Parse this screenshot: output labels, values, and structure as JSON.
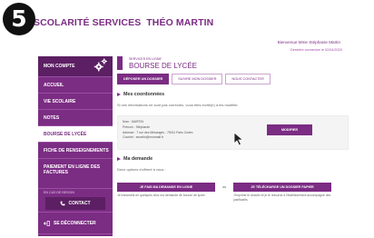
{
  "step_number": "5",
  "header": {
    "brand": "SCOLARITÉ SERVICES",
    "student_name": "THÉO MARTIN",
    "user_greeting": "Bienvenue Mme Stéphanie Martin",
    "last_login": "Dernière connexion le 02/04/2020"
  },
  "sidebar": {
    "account_label": "MON COMPTE",
    "items": [
      {
        "label": "ACCUEIL"
      },
      {
        "label": "VIE SCOLAIRE"
      },
      {
        "label": "NOTES"
      },
      {
        "label": "BOURSE DE LYCÉE"
      },
      {
        "label": "FICHE DE RENSEIGNEMENTS"
      },
      {
        "label": "PAIEMENT EN LIGNE DES FACTURES"
      }
    ],
    "active_index": 3,
    "contact_title": "EN CAS DE BESOIN",
    "contact_button": "CONTACT",
    "logout_label": "SE DÉCONNECTER"
  },
  "main": {
    "breadcrumb_small": "SERVICES EN LIGNE",
    "page_title": "BOURSE DE LYCÉE",
    "tabs": [
      {
        "label": "DÉPOSER UN DOSSIER",
        "active": true
      },
      {
        "label": "SUIVRE MON DOSSIER",
        "active": false
      },
      {
        "label": "NOUS CONTACTER",
        "active": false
      }
    ],
    "coords_heading": "Mes coordonnées",
    "coords_intro": "Si ces informations ne sont pas correctes, vous êtes invité(e) à les modifier.",
    "info_lines": [
      "Nom : MARTIN",
      "Prénom : Stéphanie",
      "Adresse : 7 rue des Mésanges - 75011 Paris Cedex",
      "Courriel : smartin@monmail.fr"
    ],
    "modify_button": "MODIFIER",
    "request_heading": "Ma demande",
    "request_intro": "Deux options s'offrent à vous :",
    "option_online_button": "JE FAIS MA DEMANDE EN LIGNE",
    "or_label": "ou",
    "option_download_button": "JE TÉLÉCHARGE UN DOSSIER PAPIER",
    "option_online_desc": "Je transmets en quelques clics ma demande de bourse de lycée.",
    "option_download_desc": "J'imprime le dossier et je le retourne à l'établissement accompagné des justificatifs."
  },
  "colors": {
    "accent": "#7b2c83",
    "accent_dark": "#5c1f63"
  },
  "icons": [
    "gear-icon",
    "phone-icon",
    "logout-icon",
    "arrow-icon",
    "mouse-cursor-icon"
  ]
}
